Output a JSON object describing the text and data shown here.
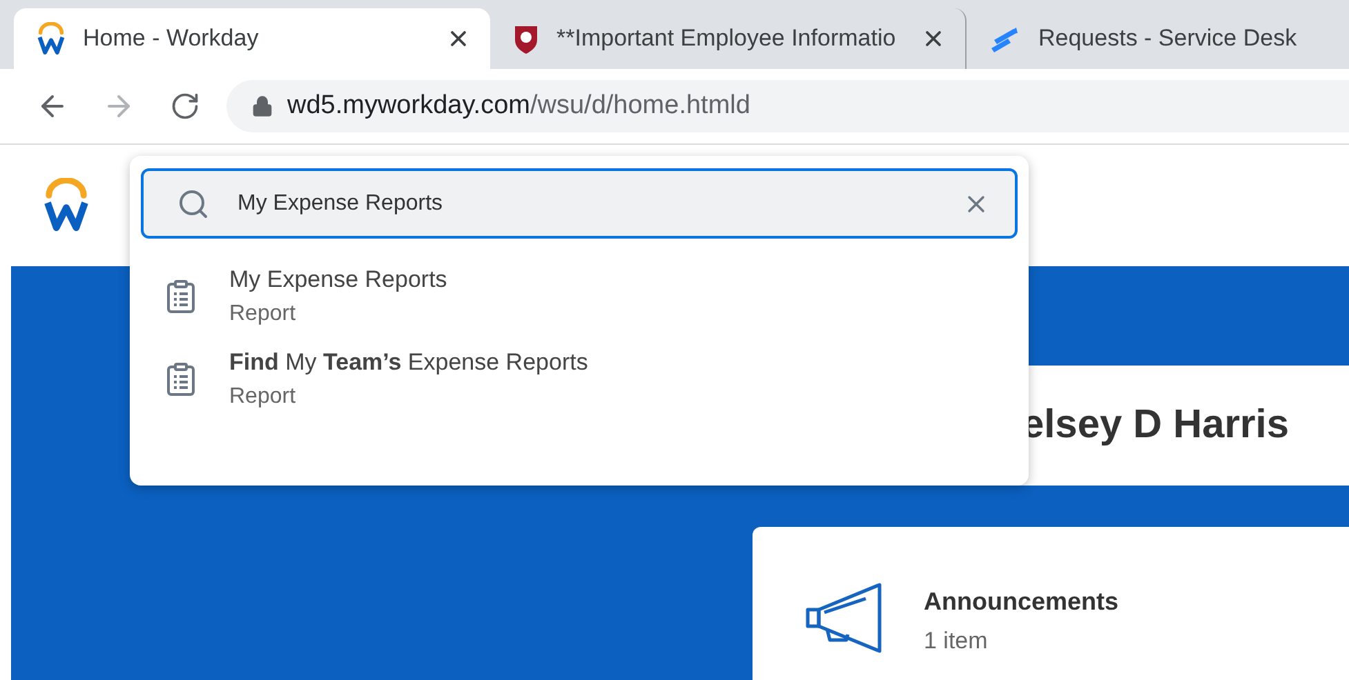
{
  "browser": {
    "tabs": [
      {
        "title": "Home - Workday",
        "selected": true,
        "kind": "workday"
      },
      {
        "title": "**Important Employee Informatio",
        "selected": false,
        "kind": "shield"
      },
      {
        "title": "Requests - Service Desk",
        "selected": false,
        "kind": "desk"
      }
    ],
    "address": {
      "host": "wd5.myworkday.com",
      "path": "/wsu/d/home.htmld"
    }
  },
  "search": {
    "value": "My Expense Reports",
    "results": [
      {
        "title": "My Expense Reports",
        "type": "Report"
      },
      {
        "title": "**Find** My **Team’s** Expense Reports",
        "type": "Report"
      }
    ]
  },
  "greeting": {
    "name": "elsey D Harris"
  },
  "cards": [
    {
      "title": "Announcements",
      "count": "1 item"
    }
  ]
}
